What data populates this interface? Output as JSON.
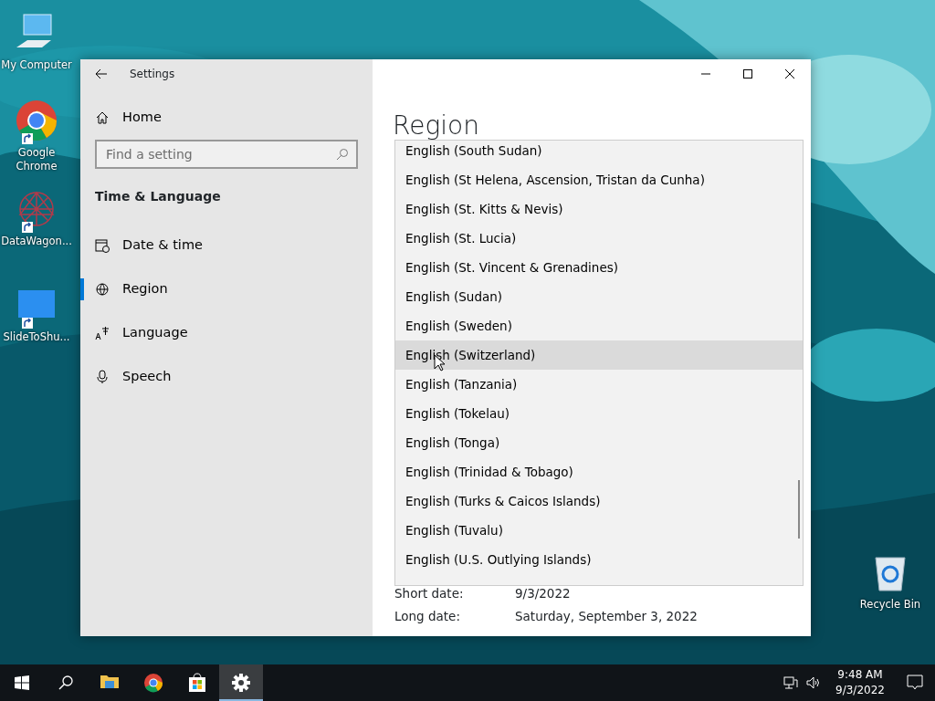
{
  "desktop_icons": [
    {
      "kind": "computer",
      "label": "My Computer",
      "shortcut": false
    },
    {
      "kind": "chrome",
      "label": "Google Chrome",
      "shortcut": true
    },
    {
      "kind": "web",
      "label": "DataWagon...",
      "shortcut": true
    },
    {
      "kind": "slide",
      "label": "SlideToShu...",
      "shortcut": true
    },
    {
      "kind": "recycle",
      "label": "Recycle Bin",
      "shortcut": false
    }
  ],
  "window": {
    "title": "Settings"
  },
  "sidebar": {
    "home": "Home",
    "search": {
      "placeholder": "Find a setting"
    },
    "section": "Time & Language",
    "items": [
      {
        "kind": "datetime",
        "label": "Date & time",
        "selected": false
      },
      {
        "kind": "region",
        "label": "Region",
        "selected": true
      },
      {
        "kind": "language",
        "label": "Language",
        "selected": false
      },
      {
        "kind": "speech",
        "label": "Speech",
        "selected": false
      }
    ]
  },
  "page_title": "Region",
  "dropdown": {
    "items": [
      {
        "label": "English (South Sudan)",
        "hovered": false
      },
      {
        "label": "English (St Helena, Ascension, Tristan da Cunha)",
        "hovered": false
      },
      {
        "label": "English (St. Kitts & Nevis)",
        "hovered": false
      },
      {
        "label": "English (St. Lucia)",
        "hovered": false
      },
      {
        "label": "English (St. Vincent & Grenadines)",
        "hovered": false
      },
      {
        "label": "English (Sudan)",
        "hovered": false
      },
      {
        "label": "English (Sweden)",
        "hovered": false
      },
      {
        "label": "English (Switzerland)",
        "hovered": true
      },
      {
        "label": "English (Tanzania)",
        "hovered": false
      },
      {
        "label": "English (Tokelau)",
        "hovered": false
      },
      {
        "label": "English (Tonga)",
        "hovered": false
      },
      {
        "label": "English (Trinidad & Tobago)",
        "hovered": false
      },
      {
        "label": "English (Turks & Caicos Islands)",
        "hovered": false
      },
      {
        "label": "English (Tuvalu)",
        "hovered": false
      },
      {
        "label": "English (U.S. Outlying Islands)",
        "hovered": false
      }
    ]
  },
  "date_formats": [
    {
      "label": "Short date:",
      "value": "9/3/2022"
    },
    {
      "label": "Long date:",
      "value": "Saturday, September 3, 2022"
    }
  ],
  "taskbar": {
    "apps": [
      {
        "kind": "explorer",
        "active": false
      },
      {
        "kind": "chrome",
        "active": false
      },
      {
        "kind": "store",
        "active": false
      },
      {
        "kind": "settings",
        "active": true
      }
    ],
    "time": "9:48 AM",
    "date": "9/3/2022"
  }
}
